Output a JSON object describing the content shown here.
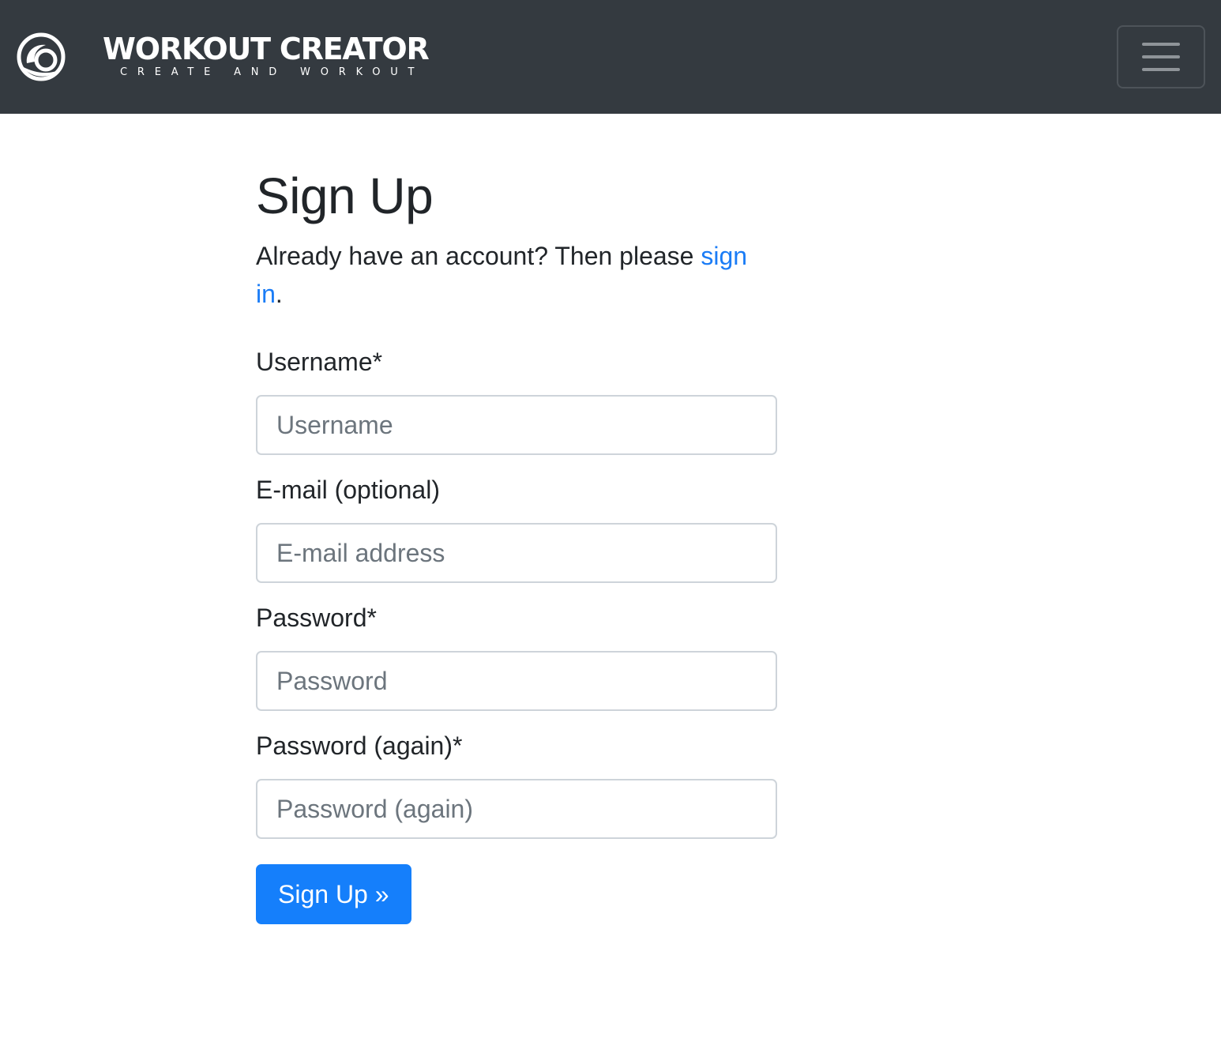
{
  "header": {
    "brand_title": "WORKOUT CREATOR",
    "brand_tagline": "CREATE AND WORKOUT",
    "logo_icon": "circle-swoosh-logo-icon",
    "menu_icon": "hamburger-menu-icon"
  },
  "main": {
    "title": "Sign Up",
    "intro_text": "Already have an account? Then please ",
    "signin_link": "sign in",
    "intro_end": ".",
    "fields": [
      {
        "label": "Username*",
        "placeholder": "Username",
        "value": ""
      },
      {
        "label": "E-mail (optional)",
        "placeholder": "E-mail address",
        "value": ""
      },
      {
        "label": "Password*",
        "placeholder": "Password",
        "value": ""
      },
      {
        "label": "Password (again)*",
        "placeholder": "Password (again)",
        "value": ""
      }
    ],
    "submit_label": "Sign Up »"
  },
  "colors": {
    "navbar_bg": "#343a40",
    "link": "#1a7cf6",
    "primary_button": "#157ffb"
  }
}
